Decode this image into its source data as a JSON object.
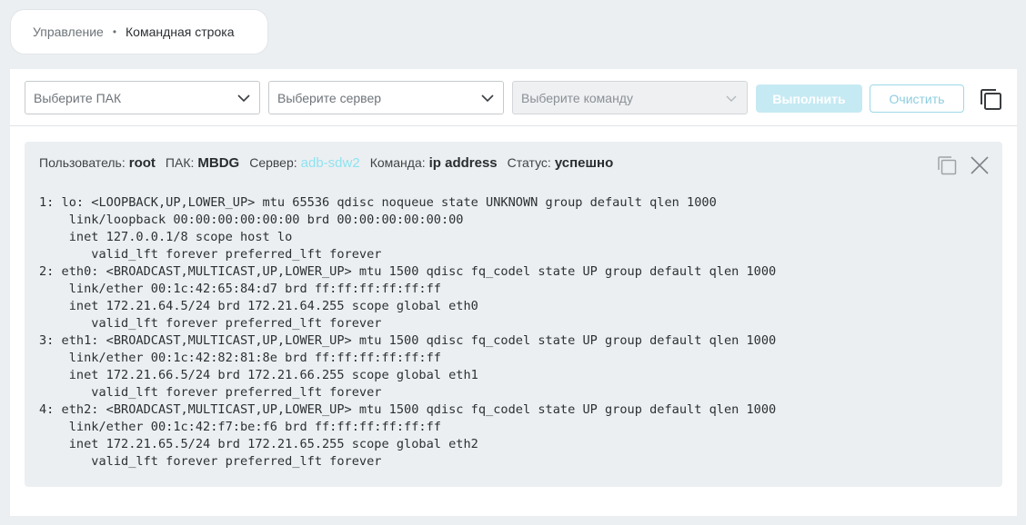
{
  "breadcrumb": {
    "root": "Управление",
    "separator": "•",
    "current": "Командная строка"
  },
  "toolbar": {
    "pak_select": {
      "placeholder": "Выберите ПАК"
    },
    "server_select": {
      "placeholder": "Выберите сервер"
    },
    "command_select": {
      "placeholder": "Выберите команду",
      "disabled": true
    },
    "run_label": "Выполнить",
    "clear_label": "Очистить",
    "copy_icon": "copy-icon"
  },
  "result": {
    "user_label": "Пользователь:",
    "user": "root",
    "pak_label": "ПАК:",
    "pak": "MBDG",
    "server_label": "Сервер:",
    "server": "adb-sdw2",
    "command_label": "Команда:",
    "command": "ip address",
    "status_label": "Статус:",
    "status": "успешно",
    "output": "1: lo: <LOOPBACK,UP,LOWER_UP> mtu 65536 qdisc noqueue state UNKNOWN group default qlen 1000\n    link/loopback 00:00:00:00:00:00 brd 00:00:00:00:00:00\n    inet 127.0.0.1/8 scope host lo\n       valid_lft forever preferred_lft forever\n2: eth0: <BROADCAST,MULTICAST,UP,LOWER_UP> mtu 1500 qdisc fq_codel state UP group default qlen 1000\n    link/ether 00:1c:42:65:84:d7 brd ff:ff:ff:ff:ff:ff\n    inet 172.21.64.5/24 brd 172.21.64.255 scope global eth0\n       valid_lft forever preferred_lft forever\n3: eth1: <BROADCAST,MULTICAST,UP,LOWER_UP> mtu 1500 qdisc fq_codel state UP group default qlen 1000\n    link/ether 00:1c:42:82:81:8e brd ff:ff:ff:ff:ff:ff\n    inet 172.21.66.5/24 brd 172.21.66.255 scope global eth1\n       valid_lft forever preferred_lft forever\n4: eth2: <BROADCAST,MULTICAST,UP,LOWER_UP> mtu 1500 qdisc fq_codel state UP group default qlen 1000\n    link/ether 00:1c:42:f7:be:f6 brd ff:ff:ff:ff:ff:ff\n    inet 172.21.65.5/24 brd 172.21.65.255 scope global eth2\n       valid_lft forever preferred_lft forever"
  },
  "colors": {
    "accent": "#8fe3f1",
    "run_button_bg": "#c6eaf3",
    "clear_button_border": "#9bd8e8",
    "output_bg": "#eceff1"
  }
}
